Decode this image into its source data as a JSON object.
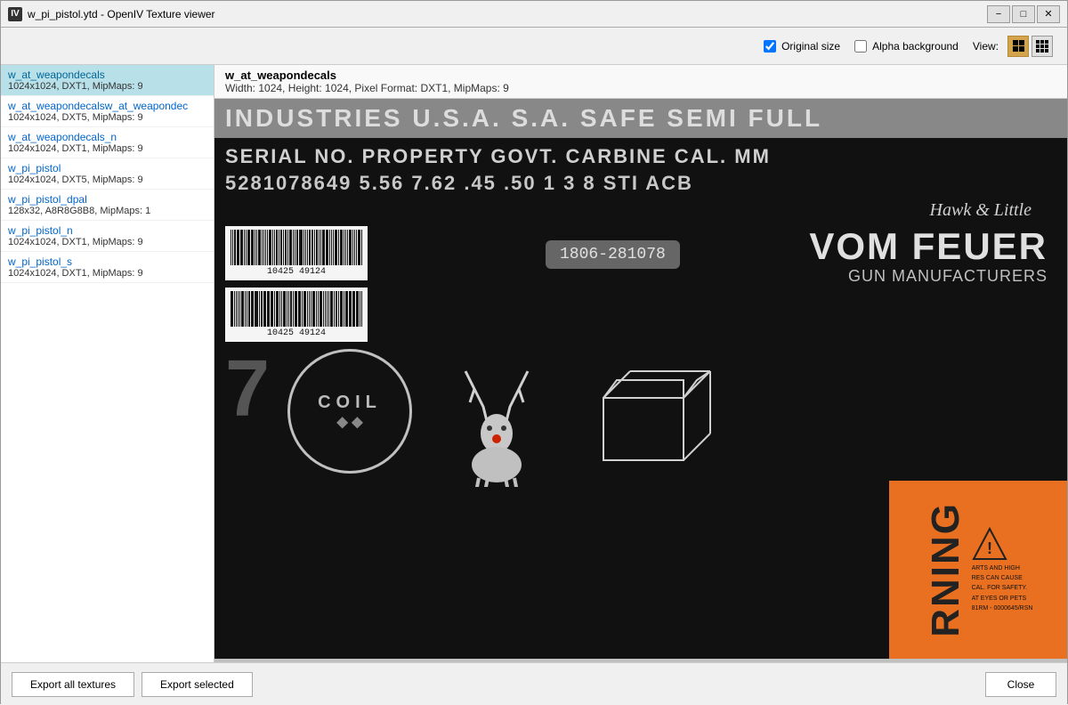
{
  "window": {
    "title": "w_pi_pistol.ytd - OpenIV Texture viewer",
    "app_icon": "IV"
  },
  "titlebar": {
    "minimize_label": "−",
    "restore_label": "□",
    "close_label": "✕"
  },
  "toolbar": {
    "original_size_label": "Original size",
    "alpha_bg_label": "Alpha background",
    "view_label": "View:",
    "original_size_checked": true,
    "alpha_bg_checked": false
  },
  "sidebar": {
    "items": [
      {
        "name": "w_at_weapondecals",
        "info": "1024x1024, DXT1, MipMaps: 9",
        "selected": true
      },
      {
        "name": "w_at_weapondecalsw_at_weapondec",
        "info": "1024x1024, DXT5, MipMaps: 9",
        "selected": false
      },
      {
        "name": "w_at_weapondecals_n",
        "info": "1024x1024, DXT1, MipMaps: 9",
        "selected": false
      },
      {
        "name": "w_pi_pistol",
        "info": "1024x1024, DXT5, MipMaps: 9",
        "selected": false
      },
      {
        "name": "w_pi_pistol_dpal",
        "info": "128x32, A8R8G8B8, MipMaps: 1",
        "selected": false
      },
      {
        "name": "w_pi_pistol_n",
        "info": "1024x1024, DXT1, MipMaps: 9",
        "selected": false
      },
      {
        "name": "w_pi_pistol_s",
        "info": "1024x1024, DXT1, MipMaps: 9",
        "selected": false
      }
    ]
  },
  "texture_info": {
    "name": "w_at_weapondecals",
    "details": "Width: 1024, Height: 1024, Pixel Format: DXT1, MipMaps: 9"
  },
  "texture": {
    "top_strip_text": "INDUSTRIES U.S.A. S.A. SAFE SEMI FULL",
    "serial_text": "SERIAL NO. PROPERTY GOVT. CARBINE CAL. MM",
    "numbers_text": "5281078649 5.56 7.62 .45 .50 1 3 8 STI ACB",
    "hawk_little": "Hawk & Little",
    "barcode_number": "10425  49124",
    "serial_badge": "1806-281078",
    "vom_feuer_title": "VOM FEUER",
    "vom_feuer_sub": "GUN MANUFACTURERS",
    "coil_text": "COIL",
    "number_7": "7",
    "warning_text": "RNING",
    "warning_side1": "ARTS AND HIGH",
    "warning_side2": "RES CAN CAUSE",
    "warning_side3": "CAL. FOR SAFETY.",
    "warning_side4": "AT EYES OR PETS",
    "warning_bottom": "81RM - 0000645/RSN"
  },
  "bottom_bar": {
    "export_all_label": "Export all textures",
    "export_selected_label": "Export selected",
    "close_label": "Close"
  }
}
